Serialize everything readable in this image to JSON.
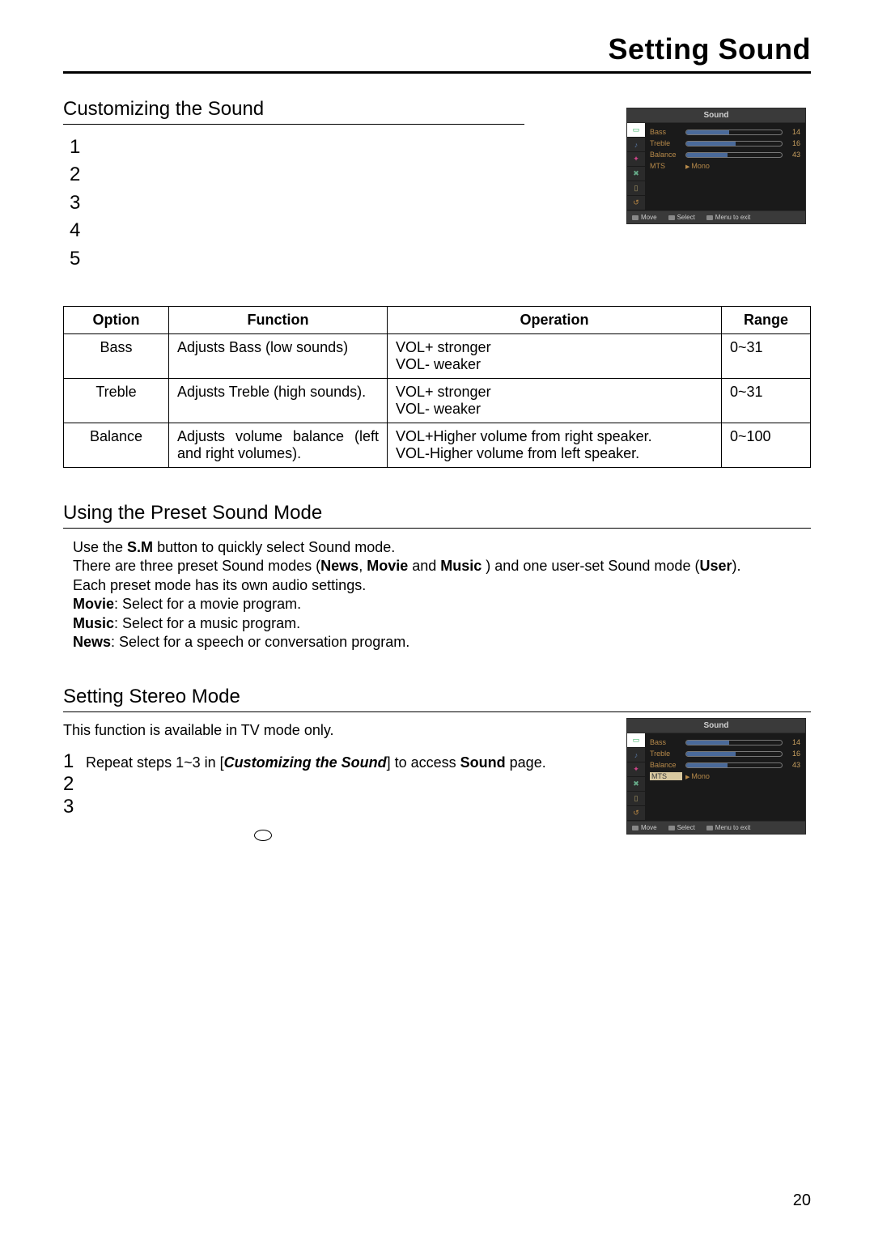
{
  "page_title": "Setting Sound",
  "page_number": "20",
  "section_customizing": {
    "title": "Customizing the Sound",
    "steps": [
      "1",
      "2",
      "3",
      "4",
      "5"
    ]
  },
  "osd1": {
    "title": "Sound",
    "rows": [
      {
        "label": "Bass",
        "value": "14",
        "fill": 45
      },
      {
        "label": "Treble",
        "value": "16",
        "fill": 52
      },
      {
        "label": "Balance",
        "value": "43",
        "fill": 43
      }
    ],
    "mts_label": "MTS",
    "mts_value": "Mono",
    "highlight_mts": false,
    "footer": {
      "move": "Move",
      "select": "Select",
      "exit": "Menu to exit"
    }
  },
  "table": {
    "headers": {
      "option": "Option",
      "function": "Function",
      "operation": "Operation",
      "range": "Range"
    },
    "rows": [
      {
        "option": "Bass",
        "function": "Adjusts Bass (low sounds)",
        "operation": "VOL+  stronger\nVOL-  weaker",
        "range": "0~31"
      },
      {
        "option": "Treble",
        "function": "Adjusts Treble (high sounds).",
        "operation": "VOL+  stronger\nVOL-  weaker",
        "range": "0~31"
      },
      {
        "option": "Balance",
        "function": "Adjusts volume balance (left and right volumes).",
        "operation": "VOL+Higher volume from right speaker.\nVOL-Higher volume from left speaker.",
        "range": "0~100"
      }
    ]
  },
  "section_preset": {
    "title": "Using the Preset Sound Mode",
    "line1_a": "Use the ",
    "line1_b": "S.M",
    "line1_c": " button to quickly select Sound mode.",
    "line2_a": "There are three preset Sound modes (",
    "line2_b": "News",
    "line2_c": ", ",
    "line2_d": "Movie",
    "line2_e": " and ",
    "line2_f": "Music",
    "line2_g": " ) and one user-set Sound mode (",
    "line2_h": "User",
    "line2_i": ").",
    "line3": "Each preset mode has its own audio  settings.",
    "line4_a": "Movie",
    "line4_b": ": Select for a movie program.",
    "line5_a": "Music",
    "line5_b": ": Select for a music program.",
    "line6_a": "News",
    "line6_b": ": Select for a speech or conversation program."
  },
  "section_stereo": {
    "title": "Setting Stereo Mode",
    "note": "This function is available in TV mode only.",
    "step1_a": "Repeat steps 1~3 in [",
    "step1_b": "Customizing the Sound",
    "step1_c": "] to access ",
    "step1_d": "Sound",
    "step1_e": " page.",
    "steps_nums": [
      "1",
      "2",
      "3"
    ]
  },
  "osd2": {
    "title": "Sound",
    "rows": [
      {
        "label": "Bass",
        "value": "14",
        "fill": 45
      },
      {
        "label": "Treble",
        "value": "16",
        "fill": 52
      },
      {
        "label": "Balance",
        "value": "43",
        "fill": 43
      }
    ],
    "mts_label": "MTS",
    "mts_value": "Mono",
    "highlight_mts": true,
    "footer": {
      "move": "Move",
      "select": "Select",
      "exit": "Menu to exit"
    }
  }
}
